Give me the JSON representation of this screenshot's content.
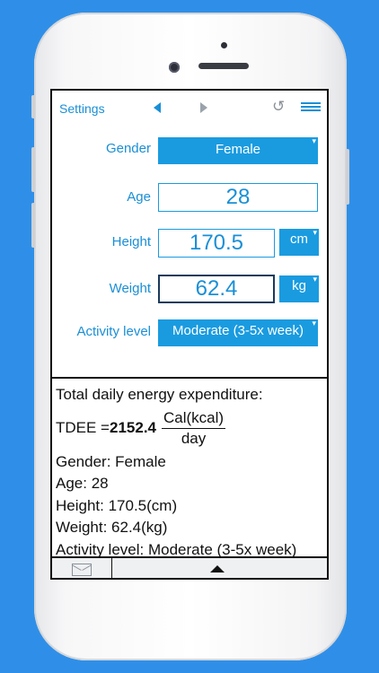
{
  "topbar": {
    "settings_label": "Settings",
    "undo_glyph": "↺"
  },
  "form": {
    "gender": {
      "label": "Gender",
      "value": "Female"
    },
    "age": {
      "label": "Age",
      "value": "28"
    },
    "height": {
      "label": "Height",
      "value": "170.5",
      "unit": "cm"
    },
    "weight": {
      "label": "Weight",
      "value": "62.4",
      "unit": "kg"
    },
    "activity": {
      "label": "Activity level",
      "value": "Moderate (3-5x week)"
    },
    "caret": "▾"
  },
  "results": {
    "heading": "Total daily energy expenditure:",
    "tdee_prefix": "TDEE = ",
    "tdee_value": "2152.4",
    "unit_numerator": "Cal(kcal)",
    "unit_denominator": "day",
    "lines": [
      "Gender: Female",
      "Age: 28",
      "Height: 170.5(cm)",
      "Weight: 62.4(kg)",
      "Activity level: Moderate (3-5x week)"
    ]
  },
  "colors": {
    "accent": "#1a9be0",
    "background": "#2f8fe8"
  }
}
